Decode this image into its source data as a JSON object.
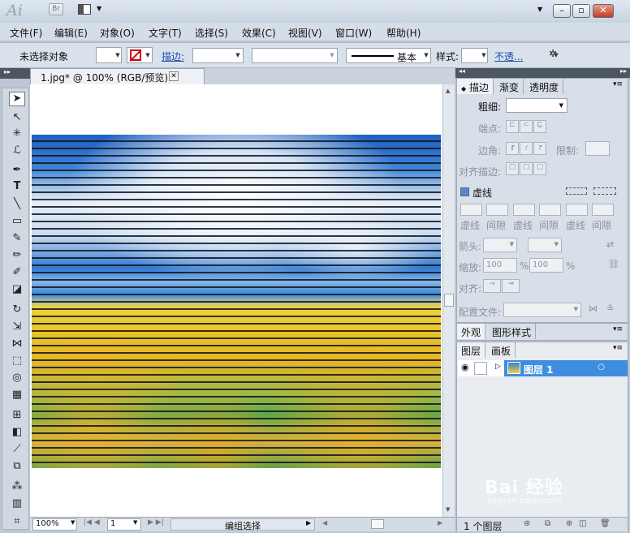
{
  "app": {
    "logo": "Ai",
    "bridge": "Br"
  },
  "menu": [
    "文件(F)",
    "编辑(E)",
    "对象(O)",
    "文字(T)",
    "选择(S)",
    "效果(C)",
    "视图(V)",
    "窗口(W)",
    "帮助(H)"
  ],
  "control": {
    "selection": "未选择对象",
    "stroke_label": "描边:",
    "basic": "基本",
    "style_label": "样式:",
    "opacity_link": "不透..."
  },
  "document": {
    "tab_title": "1.jpg* @ 100% (RGB/预览)"
  },
  "stroke_panel": {
    "tabs": [
      "描边",
      "渐变",
      "透明度"
    ],
    "weight_label": "粗细:",
    "cap_label": "端点:",
    "corner_label": "边角:",
    "limit_label": "限制:",
    "align_label": "对齐描边:",
    "dashed_label": "虚线",
    "dash_labels": [
      "虚线",
      "间隙",
      "虚线",
      "间隙",
      "虚线",
      "间隙"
    ],
    "arrow_label": "箭头:",
    "scale_label": "缩放:",
    "scale_value1": "100",
    "scale_value2": "100",
    "percent": "%",
    "align2_label": "对齐:",
    "profile_label": "配置文件:"
  },
  "appearance_panel": {
    "tabs": [
      "外观",
      "图形样式"
    ]
  },
  "layers_panel": {
    "tabs": [
      "图层",
      "画板"
    ],
    "layer_name": "图层 1",
    "footer": "1 个图层"
  },
  "status": {
    "zoom": "100%",
    "page": "1",
    "mode": "编组选择"
  },
  "watermark": {
    "brand": "Bai 经验",
    "url": "jingyan.baidu.com"
  },
  "colors": {
    "layer_highlight": "#3d8de0",
    "ui_bg": "#bdc7d3"
  }
}
